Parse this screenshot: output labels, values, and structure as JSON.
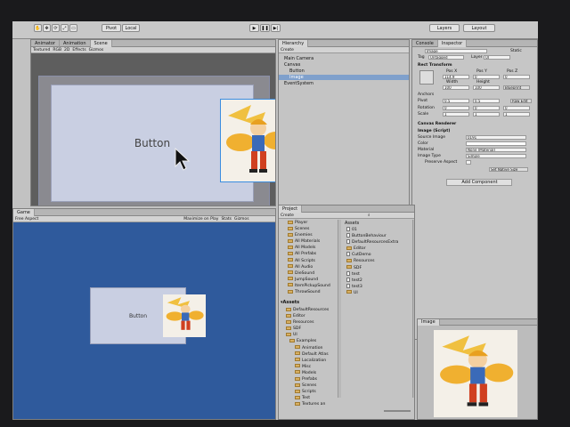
{
  "toolbar": {
    "pivot": "Pivot",
    "local": "Local",
    "layers": "Layers",
    "layout": "Layout"
  },
  "scene": {
    "tab_animator": "Animator",
    "tab_animation": "Animation",
    "tab_scene": "Scene",
    "shading": "Textured",
    "rgb": "RGB",
    "mode_2d": "2D",
    "effects": "Effects",
    "gizmos": "Gizmos",
    "button_text": "Button"
  },
  "hierarchy": {
    "tab": "Hierarchy",
    "create": "Create",
    "items": [
      "Main Camera",
      "Canvas",
      "Button",
      "Image",
      "EventSystem"
    ]
  },
  "inspector": {
    "tab_console": "Console",
    "tab_inspector": "Inspector",
    "object_name": "Image",
    "static": "Static",
    "tag_label": "Tag",
    "tag_value": "Untagged",
    "layer_label": "Layer",
    "layer_value": "UI",
    "rect_transform": "Rect Transform",
    "pos_x": "Pos X",
    "pos_y": "Pos Y",
    "pos_z": "Pos Z",
    "pos_x_val": "114.9",
    "pos_y_val": "0",
    "pos_z_val": "0",
    "width": "Width",
    "height": "Height",
    "width_val": "100",
    "height_val": "100",
    "blueprint": "Blueprint",
    "anchors": "Anchors",
    "pivot_label": "Pivot",
    "pivot_x": "0.5",
    "pivot_y": "0.5",
    "raw_edit": "Raw Edit",
    "rotation_label": "Rotation",
    "rot_x": "0",
    "rot_y": "0",
    "rot_z": "0",
    "scale_label": "Scale",
    "scale_x": "1",
    "scale_y": "1",
    "scale_z": "1",
    "canvas_renderer": "Canvas Renderer",
    "image_script": "Image (Script)",
    "source_image_label": "Source Image",
    "source_image_val": "0191",
    "color_label": "Color",
    "material_label": "Material",
    "material_val": "None (Material)",
    "image_type_label": "Image Type",
    "image_type_val": "Simple",
    "preserve_aspect_label": "Preserve Aspect",
    "set_native_size": "Set Native Size",
    "add_component": "Add Component",
    "preview_tab": "Image"
  },
  "game": {
    "tab": "Game",
    "aspect": "Free Aspect",
    "maximize": "Maximize on Play",
    "stats": "Stats",
    "gizmos": "Gizmos",
    "button_text": "Button"
  },
  "project": {
    "tab": "Project",
    "create": "Create",
    "favorites": [
      "Player",
      "Scenes",
      "Enemies",
      "All Materials",
      "All Models",
      "All Prefabs",
      "All Scripts",
      "All Audio",
      "DieSound",
      "JumpSound",
      "ItemPickupSound",
      "ThrowSound"
    ],
    "assets_root": "Assets",
    "tree": [
      "DefaultResources",
      "Editor",
      "Resources",
      "SDF",
      "UI",
      "Examples",
      "Animation",
      "Default Atlas",
      "Localization",
      "Misc",
      "Models",
      "Prefabs",
      "Scenes",
      "Scripts",
      "Test",
      "Textures an"
    ],
    "assets_header": "Assets",
    "assets": [
      "01",
      "ButtonBehaviour",
      "DefaultResourcesExtra",
      "Editor",
      "CutDemo",
      "Resources",
      "SDF",
      "test",
      "test2",
      "test3",
      "UI"
    ]
  },
  "colors": {
    "game_bg": "#2f5a9c",
    "scene_bg": "#5e5e5e",
    "canvas_rect": "#c9cfe2",
    "selection": "#7fa0cc"
  }
}
